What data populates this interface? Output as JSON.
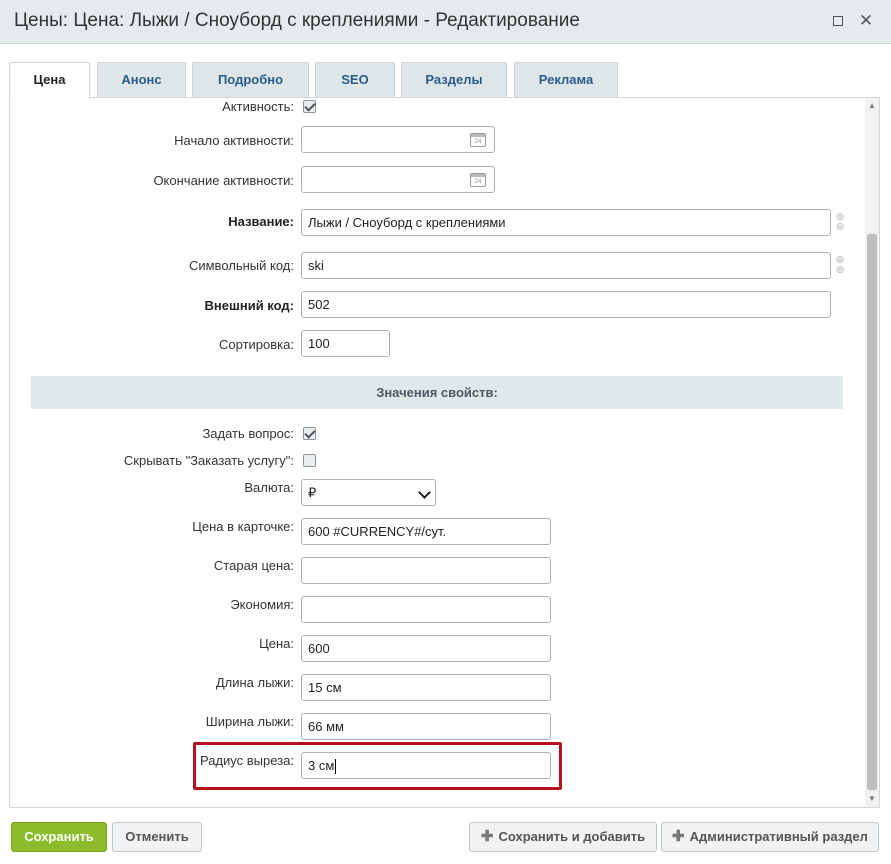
{
  "window": {
    "title": "Цены: Цена: Лыжи / Сноуборд с креплениями - Редактирование",
    "maximize_glyph": "",
    "close_glyph": "✕"
  },
  "tabs": [
    {
      "label": "Цена",
      "active": true
    },
    {
      "label": "Анонс"
    },
    {
      "label": "Подробно"
    },
    {
      "label": "SEO"
    },
    {
      "label": "Разделы"
    },
    {
      "label": "Реклама"
    }
  ],
  "form": {
    "active": {
      "label": "Активность:",
      "checked": true
    },
    "start_date": {
      "label": "Начало активности:",
      "value": ""
    },
    "end_date": {
      "label": "Окончание активности:",
      "value": ""
    },
    "name": {
      "label": "Название:",
      "value": "Лыжи / Сноуборд с креплениями"
    },
    "code": {
      "label": "Символьный код:",
      "value": "ski"
    },
    "external_code": {
      "label": "Внешний код:",
      "value": "502"
    },
    "sort": {
      "label": "Сортировка:",
      "value": "100"
    },
    "calendar_day": "24"
  },
  "properties": {
    "section_title": "Значения свойств:",
    "ask_question": {
      "label": "Задать вопрос:",
      "checked": true
    },
    "hide_order": {
      "label": "Скрывать \"Заказать услугу\":",
      "checked": false
    },
    "currency": {
      "label": "Валюта:",
      "value": "₽"
    },
    "card_price": {
      "label": "Цена в карточке:",
      "value": "600 #CURRENCY#/сут."
    },
    "old_price": {
      "label": "Старая цена:",
      "value": ""
    },
    "economy": {
      "label": "Экономия:",
      "value": ""
    },
    "price": {
      "label": "Цена:",
      "value": "600"
    },
    "ski_length": {
      "label": "Длина лыжи:",
      "value": "15 см"
    },
    "ski_width": {
      "label": "Ширина лыжи:",
      "value": "66 мм"
    },
    "cut_radius": {
      "label": "Радиус выреза:",
      "value": "3 см"
    }
  },
  "buttons": {
    "save": "Сохранить",
    "cancel": "Отменить",
    "save_add": "Сохранить и добавить",
    "admin": "Административный раздел"
  },
  "colors": {
    "save_button": "#8cbc2b",
    "highlight_border": "#b3121c",
    "tab_text": "#2a5b8a"
  }
}
